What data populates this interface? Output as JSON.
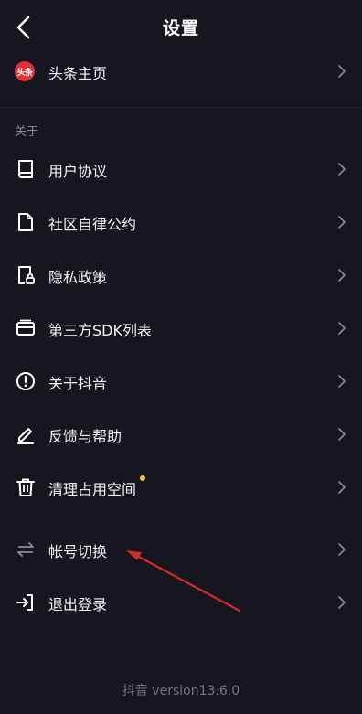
{
  "header": {
    "title": "设置"
  },
  "profile_row": {
    "badge_text": "头条",
    "label": "头条主页"
  },
  "section_about": {
    "label": "关于"
  },
  "menu": [
    {
      "label": "用户协议",
      "icon": "book-icon"
    },
    {
      "label": "社区自律公约",
      "icon": "document-icon"
    },
    {
      "label": "隐私政策",
      "icon": "privacy-lock-icon"
    },
    {
      "label": "第三方SDK列表",
      "icon": "card-icon"
    },
    {
      "label": "关于抖音",
      "icon": "info-circle-icon"
    },
    {
      "label": "反馈与帮助",
      "icon": "edit-pen-icon"
    },
    {
      "label": "清理占用空间",
      "icon": "trash-icon",
      "has_dot": true
    },
    {
      "label": "帐号切换",
      "icon": "swap-arrows-icon"
    },
    {
      "label": "退出登录",
      "icon": "logout-icon"
    }
  ],
  "footer": {
    "version": "抖音 version13.6.0"
  },
  "colors": {
    "background": "#16161f",
    "badge_red": "#e0313a",
    "dot_yellow": "#f5c52b",
    "annotation_arrow": "#d42a2a"
  }
}
